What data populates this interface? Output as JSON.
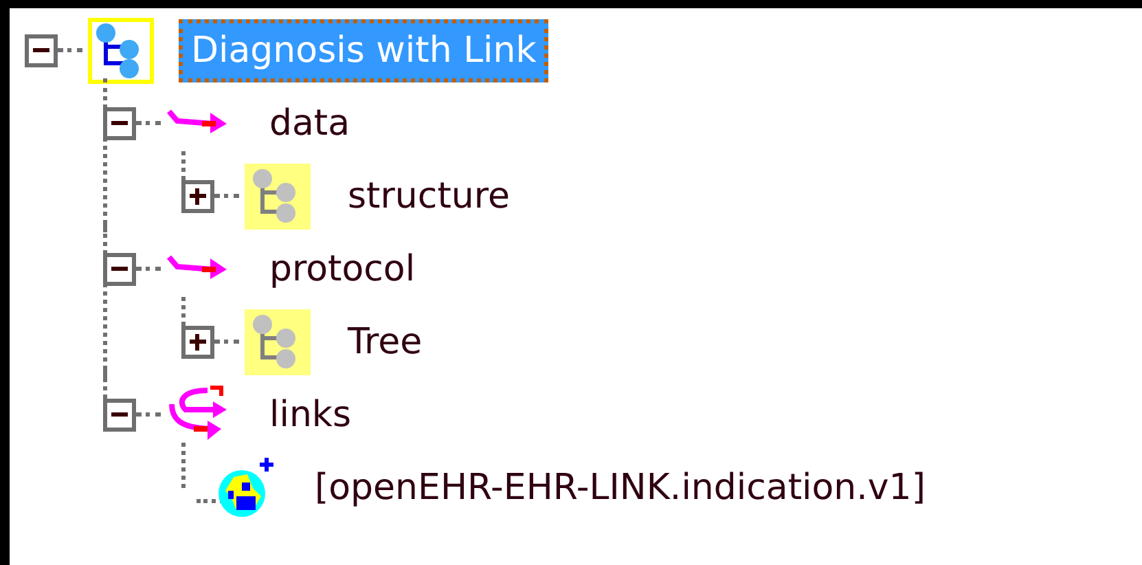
{
  "tree": [
    {
      "label": "Diagnosis with Link",
      "kind": "archetype",
      "expanded": true,
      "selected": true,
      "children": [
        {
          "label": "data",
          "kind": "attribute",
          "expanded": true,
          "selected": false,
          "children": [
            {
              "label": "structure",
              "kind": "tree",
              "expanded": false,
              "selected": false
            }
          ]
        },
        {
          "label": "protocol",
          "kind": "attribute",
          "expanded": true,
          "selected": false,
          "children": [
            {
              "label": "Tree",
              "kind": "tree",
              "expanded": false,
              "selected": false
            }
          ]
        },
        {
          "label": "links",
          "kind": "links",
          "expanded": true,
          "selected": false,
          "children": [
            {
              "label": "[openEHR-EHR-LINK.indication.v1]",
              "kind": "link",
              "selected": false
            }
          ]
        }
      ]
    }
  ]
}
